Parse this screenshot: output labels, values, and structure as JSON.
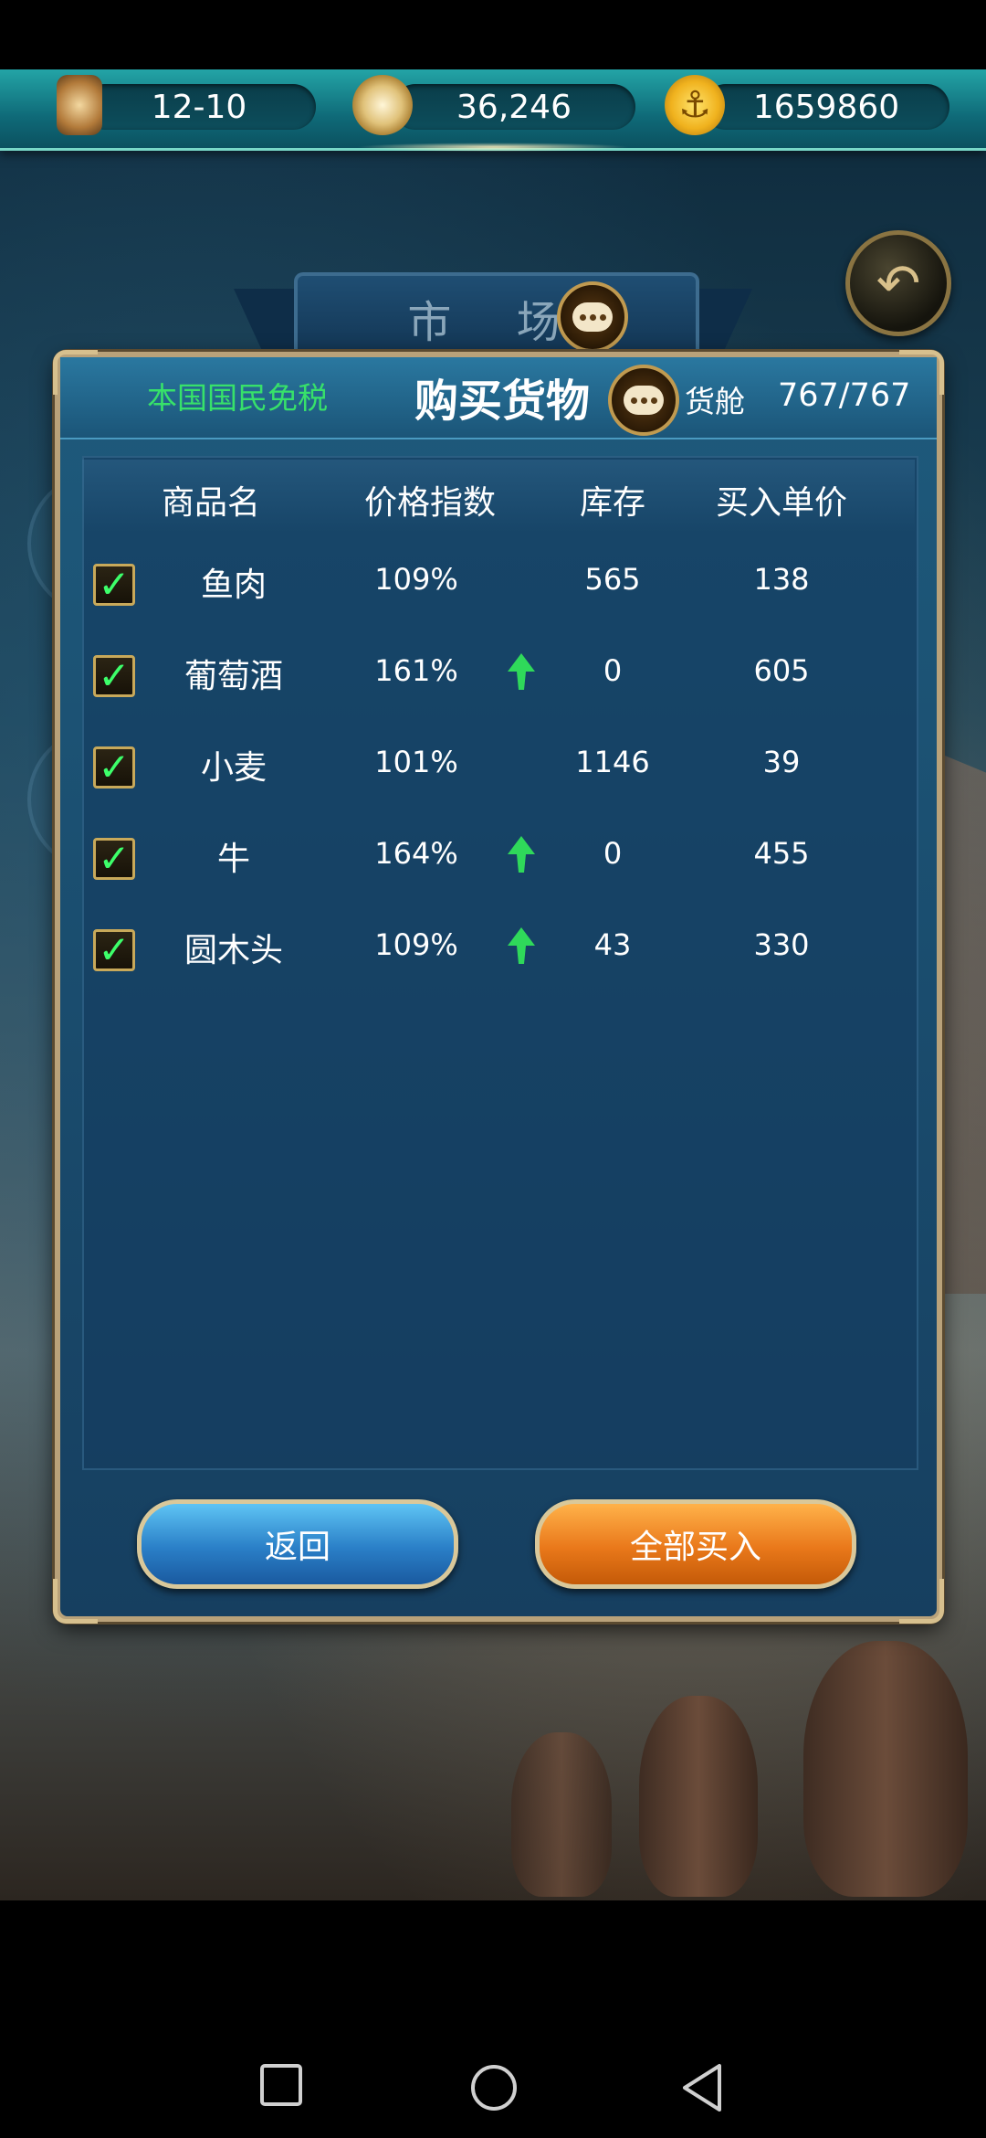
{
  "hud": {
    "date": "12-10",
    "compass_value": "36,246",
    "gold": "1659860",
    "icons": [
      "hourglass-icon",
      "compass-icon",
      "anchor-coin-icon"
    ]
  },
  "market_tab": {
    "label": "市 场"
  },
  "panel": {
    "tax_note": "本国国民免税",
    "title": "购买货物",
    "cargo_label": "货舱",
    "cargo_value": "767/767",
    "columns": [
      "商品名",
      "价格指数",
      "库存",
      "买入单价"
    ],
    "rows": [
      {
        "name": "鱼肉",
        "price_index": "109%",
        "rising": false,
        "stock": "565",
        "unit_price": "138",
        "checked": true
      },
      {
        "name": "葡萄酒",
        "price_index": "161%",
        "rising": true,
        "stock": "0",
        "unit_price": "605",
        "checked": true
      },
      {
        "name": "小麦",
        "price_index": "101%",
        "rising": false,
        "stock": "1146",
        "unit_price": "39",
        "checked": true
      },
      {
        "name": "牛",
        "price_index": "164%",
        "rising": true,
        "stock": "0",
        "unit_price": "455",
        "checked": true
      },
      {
        "name": "圆木头",
        "price_index": "109%",
        "rising": true,
        "stock": "43",
        "unit_price": "330",
        "checked": true
      }
    ],
    "back_button": "返回",
    "buy_all_button": "全部买入"
  },
  "colors": {
    "tax_note": "#37e16a",
    "rising_arrow": "#2fd95a",
    "checkmark": "#3dff6a",
    "back_button": "#2a7fc7",
    "buy_all_button": "#e9781a"
  }
}
